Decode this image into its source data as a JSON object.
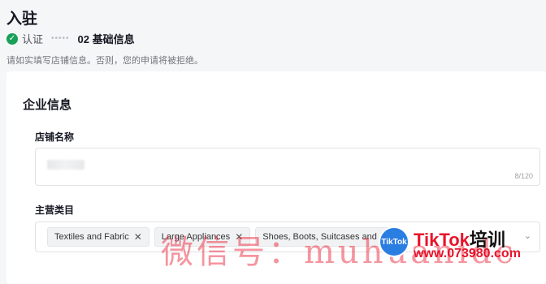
{
  "header": {
    "title": "入驻",
    "steps": [
      {
        "label": "认证",
        "status": "done"
      },
      {
        "label": "02 基础信息",
        "status": "current"
      }
    ],
    "hint": "请如实填写店铺信息。否则，您的申请将被拒绝。"
  },
  "form": {
    "section_title": "企业信息",
    "store_name": {
      "label": "店铺名称",
      "counter": "8/120"
    },
    "category": {
      "label": "主营类目",
      "tags": [
        {
          "label": "Textiles and Fabric"
        },
        {
          "label": "Large Appliances"
        },
        {
          "label": "Shoes, Boots, Suitcases and"
        }
      ]
    }
  },
  "watermark": {
    "wechat_text": "微信号：muhuanidc",
    "logo_text": "TikTok",
    "brand_latin": "TikTok",
    "brand_cn": "培训",
    "url": "www.073980.com"
  },
  "colors": {
    "success": "#18a058",
    "watermark_red": "#e8142b",
    "watermark_logo": "#2a7de1"
  }
}
